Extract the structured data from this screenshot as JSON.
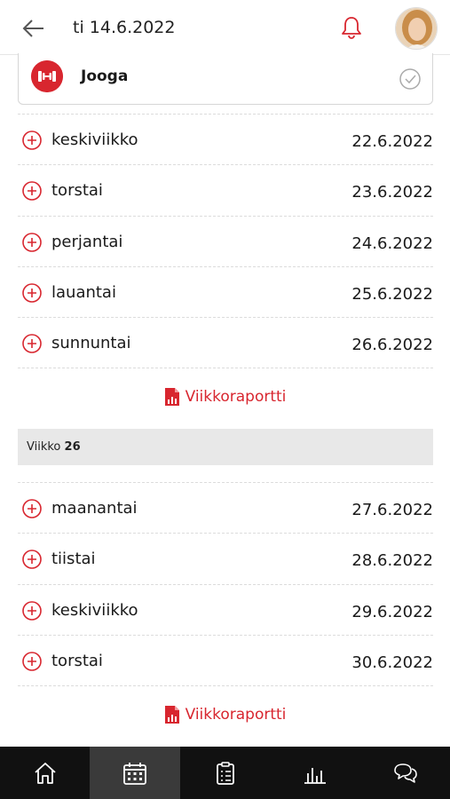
{
  "header": {
    "title": "ti 14.6.2022",
    "back_icon": "arrow-left-icon",
    "bell_icon": "bell-icon",
    "accent": "#d8262f"
  },
  "activity": {
    "label": "Jooga",
    "icon": "dumbbell-icon",
    "status_icon": "check-circle-icon"
  },
  "week_a_days": [
    {
      "day": "keskiviikko",
      "date": "22.6.2022"
    },
    {
      "day": "torstai",
      "date": "23.6.2022"
    },
    {
      "day": "perjantai",
      "date": "24.6.2022"
    },
    {
      "day": "lauantai",
      "date": "25.6.2022"
    },
    {
      "day": "sunnuntai",
      "date": "26.6.2022"
    }
  ],
  "report_label": "Viikkoraportti",
  "week_header": {
    "prefix": "Viikko",
    "number": "26"
  },
  "week_b_days": [
    {
      "day": "maanantai",
      "date": "27.6.2022"
    },
    {
      "day": "tiistai",
      "date": "28.6.2022"
    },
    {
      "day": "keskiviikko",
      "date": "29.6.2022"
    },
    {
      "day": "torstai",
      "date": "30.6.2022"
    }
  ],
  "tabbar": {
    "tabs": [
      "home-icon",
      "calendar-icon",
      "clipboard-icon",
      "chart-icon",
      "chat-icon"
    ],
    "active": "calendar-icon"
  }
}
